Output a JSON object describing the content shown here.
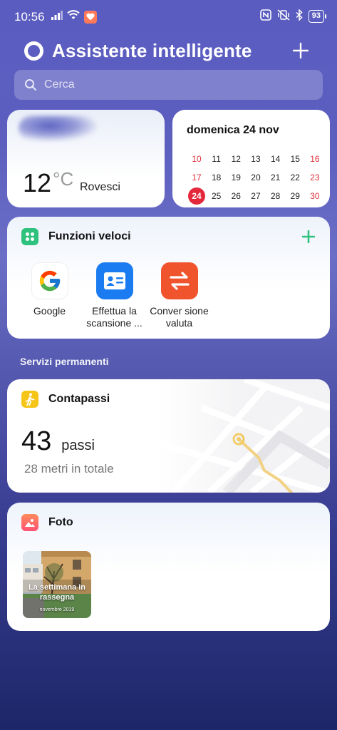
{
  "status_bar": {
    "time": "10:56",
    "battery": "93",
    "icons": [
      "signal-icon",
      "wifi-icon",
      "health-app-icon",
      "nfc-icon",
      "mute-vibrate-icon",
      "bluetooth-icon",
      "battery-icon"
    ]
  },
  "header": {
    "title": "Assistente intelligente",
    "add_icon": "plus-icon"
  },
  "search": {
    "placeholder": "Cerca"
  },
  "weather": {
    "temperature": "12",
    "unit": "°C",
    "description": "Rovesci"
  },
  "calendar": {
    "title": "domenica 24 nov",
    "rows": [
      [
        "10",
        "11",
        "12",
        "13",
        "14",
        "15",
        "16"
      ],
      [
        "17",
        "18",
        "19",
        "20",
        "21",
        "22",
        "23"
      ],
      [
        "24",
        "25",
        "26",
        "27",
        "28",
        "29",
        "30"
      ]
    ],
    "today": "24",
    "accent_color": "#e4283c"
  },
  "quick_functions": {
    "title": "Funzioni veloci",
    "accent_color": "#2ec27e",
    "apps": [
      {
        "label": "Google",
        "icon": "google-icon"
      },
      {
        "label": "Effettua la scansione ...",
        "icon": "id-card-scan-icon",
        "color": "#1a7cf0"
      },
      {
        "label": "Conver sione valuta",
        "icon": "currency-exchange-icon",
        "color": "#f0542d"
      }
    ]
  },
  "sections": {
    "permanent_services": "Servizi permanenti"
  },
  "steps": {
    "title": "Contapassi",
    "count": "43",
    "unit": "passi",
    "total": "28 metri in totale",
    "icon_color": "#f5c518"
  },
  "photos": {
    "title": "Foto",
    "thumbnail_title": "La settimana in rassegna",
    "thumbnail_subtitle": "novembre 2019"
  }
}
